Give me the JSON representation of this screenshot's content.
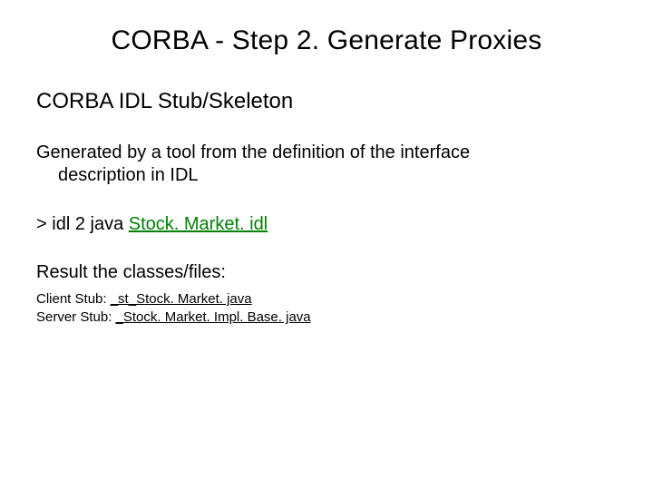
{
  "title": "CORBA - Step 2. Generate Proxies",
  "subhead": "CORBA IDL Stub/Skeleton",
  "para_line1": "Generated by a tool from the definition of the interface",
  "para_line2": "description in IDL",
  "cmd_prompt": ">",
  "cmd_tool": "idl 2 java",
  "cmd_arg": "Stock. Market. idl",
  "result_label": "Result the classes/files:",
  "client_label": "Client Stub: ",
  "client_file": "_st_Stock. Market. java",
  "server_label": "Server Stub: ",
  "server_file": "_Stock. Market. Impl. Base. java"
}
